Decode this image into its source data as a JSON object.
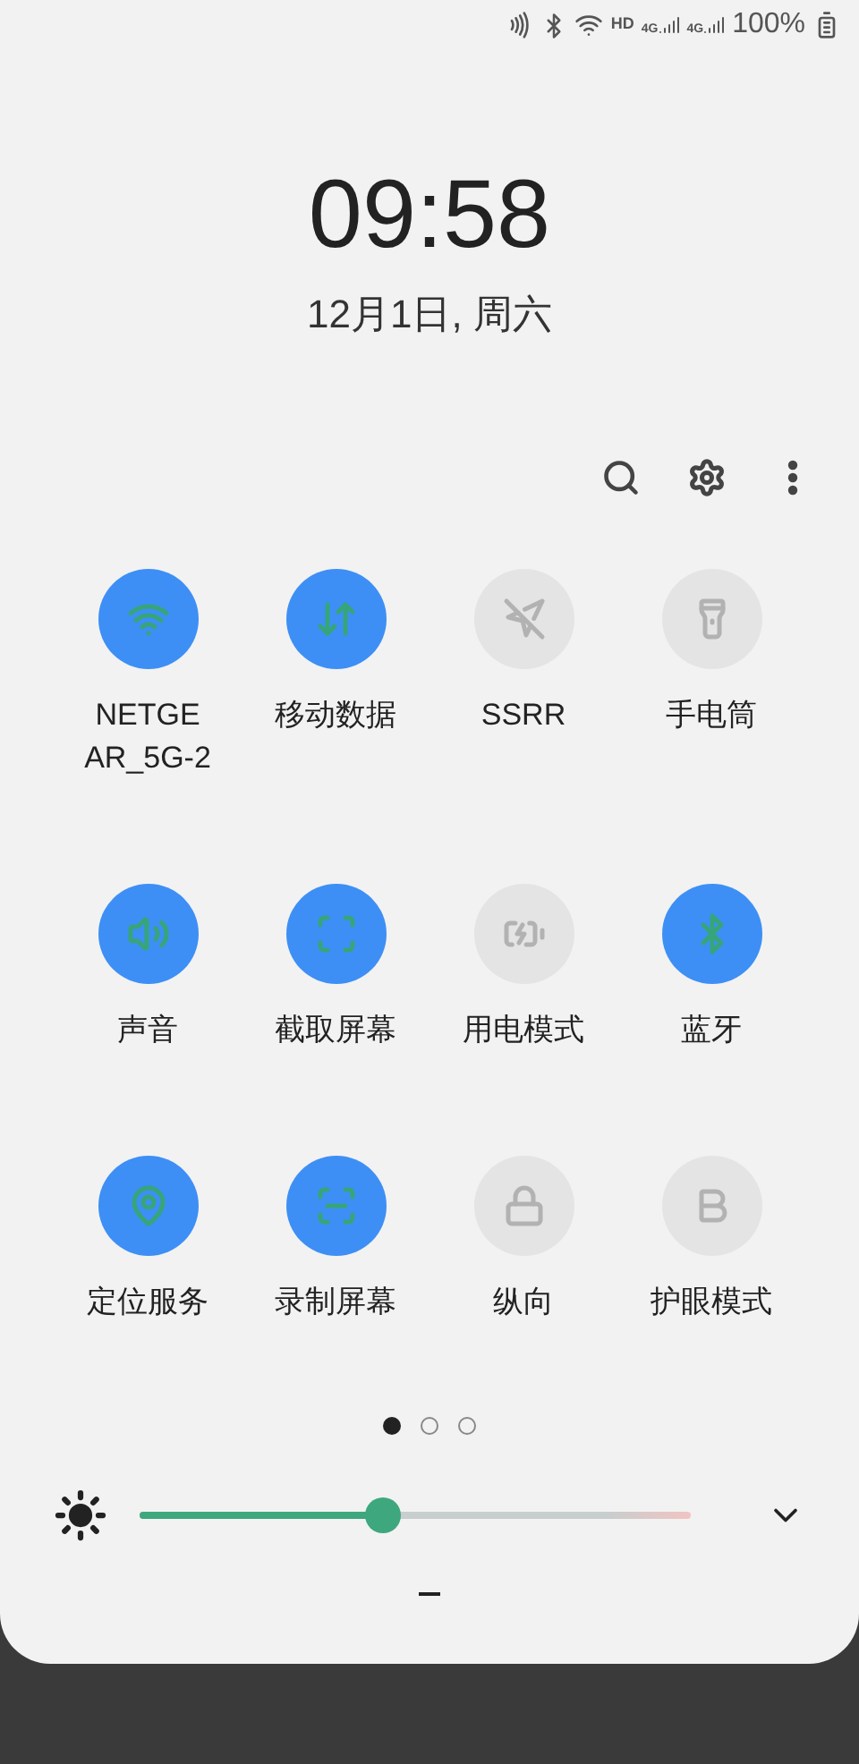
{
  "status_bar": {
    "network": "HD",
    "sims": [
      "4G",
      "4G"
    ],
    "battery": "100%"
  },
  "clock": {
    "time": "09:58",
    "date": "12月1日, 周六"
  },
  "tiles": [
    {
      "label": "NETGE AR_5G-2",
      "kind": "wifi",
      "on": true
    },
    {
      "label": "移动数据",
      "kind": "data",
      "on": true
    },
    {
      "label": "SSRR",
      "kind": "vpn",
      "on": false
    },
    {
      "label": "手电筒",
      "kind": "flashlight",
      "on": false
    },
    {
      "label": "声音",
      "kind": "sound",
      "on": true
    },
    {
      "label": "截取屏幕",
      "kind": "screenshot",
      "on": true
    },
    {
      "label": "用电模式",
      "kind": "power",
      "on": false
    },
    {
      "label": "蓝牙",
      "kind": "bluetooth",
      "on": true
    },
    {
      "label": "定位服务",
      "kind": "location",
      "on": true
    },
    {
      "label": "录制屏幕",
      "kind": "record",
      "on": true
    },
    {
      "label": "纵向",
      "kind": "rotation",
      "on": false
    },
    {
      "label": "护眼模式",
      "kind": "eyecare",
      "on": false
    }
  ],
  "pages": [
    {
      "selected": true
    },
    {
      "selected": false
    },
    {
      "selected": false
    }
  ],
  "brightness": {
    "level": 0.44
  }
}
